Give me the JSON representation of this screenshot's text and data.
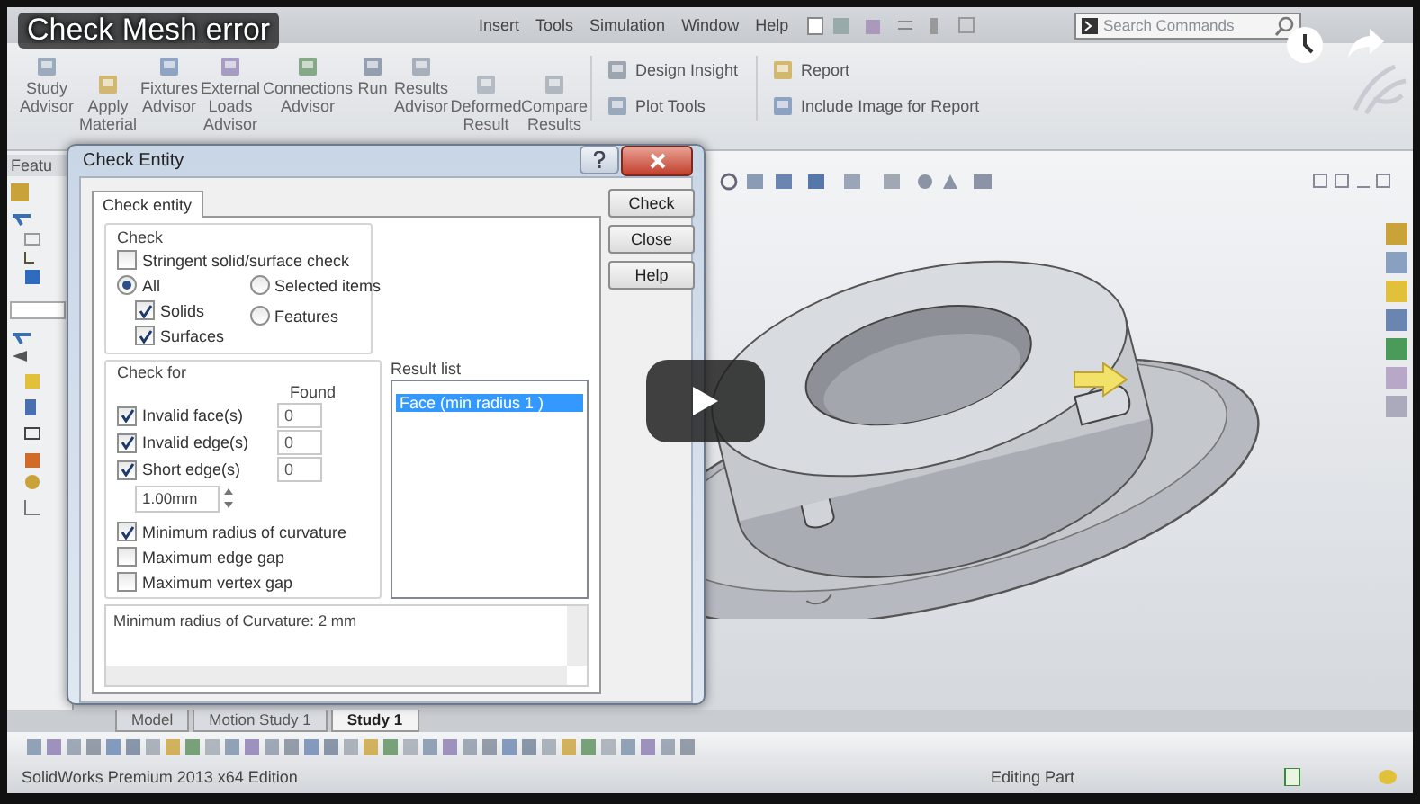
{
  "video": {
    "title": "Check Mesh error"
  },
  "menu": [
    "Insert",
    "Tools",
    "Simulation",
    "Window",
    "Help"
  ],
  "search": {
    "placeholder": "Search Commands"
  },
  "ribbon": [
    {
      "label": "Study Advisor",
      "kind": "large"
    },
    {
      "label": "Apply Material",
      "kind": "large"
    },
    {
      "label": "Fixtures Advisor",
      "kind": "large"
    },
    {
      "label": "External Loads Advisor",
      "kind": "large"
    },
    {
      "label": "Connections Advisor",
      "kind": "large"
    },
    {
      "label": "Run",
      "kind": "large"
    },
    {
      "label": "Results Advisor",
      "kind": "large"
    },
    {
      "label": "Deformed Result",
      "kind": "large"
    },
    {
      "label": "Compare Results",
      "kind": "large"
    },
    {
      "label": "Design Insight",
      "kind": "small"
    },
    {
      "label": "Plot Tools",
      "kind": "small"
    },
    {
      "label": "Report",
      "kind": "small"
    },
    {
      "label": "Include Image for Report",
      "kind": "small"
    }
  ],
  "feature_tab": "Featu",
  "dialog": {
    "title": "Check Entity",
    "tab": "Check entity",
    "check_group": "Check",
    "stringent": {
      "label": "Stringent solid/surface check",
      "checked": false
    },
    "scope": [
      {
        "label": "All",
        "selected": true
      },
      {
        "label": "Selected items",
        "selected": false
      },
      {
        "label": "Features",
        "selected": false
      }
    ],
    "bodies": [
      {
        "label": "Solids",
        "checked": true
      },
      {
        "label": "Surfaces",
        "checked": true
      }
    ],
    "check_for_group": "Check for",
    "found_header": "Found",
    "checks": [
      {
        "label": "Invalid face(s)",
        "checked": true,
        "found": "0"
      },
      {
        "label": "Invalid edge(s)",
        "checked": true,
        "found": "0"
      },
      {
        "label": "Short edge(s)",
        "checked": true,
        "found": "0"
      }
    ],
    "short_edge_length": "1.00mm",
    "options": [
      {
        "label": "Minimum radius of curvature",
        "checked": true
      },
      {
        "label": "Maximum edge gap",
        "checked": false
      },
      {
        "label": "Maximum vertex gap",
        "checked": false
      }
    ],
    "result_list": {
      "label": "Result list",
      "items": [
        {
          "label": "Face (min radius 1 )",
          "selected": true
        }
      ]
    },
    "message": "Minimum radius of Curvature: 2 mm",
    "buttons": [
      "Check",
      "Close",
      "Help"
    ]
  },
  "bottom_tabs": [
    {
      "label": "Model",
      "selected": false
    },
    {
      "label": "Motion Study 1",
      "selected": false
    },
    {
      "label": "Study 1",
      "selected": true
    }
  ],
  "status_bar": {
    "edition": "SolidWorks Premium 2013 x64 Edition",
    "mode": "Editing Part"
  }
}
